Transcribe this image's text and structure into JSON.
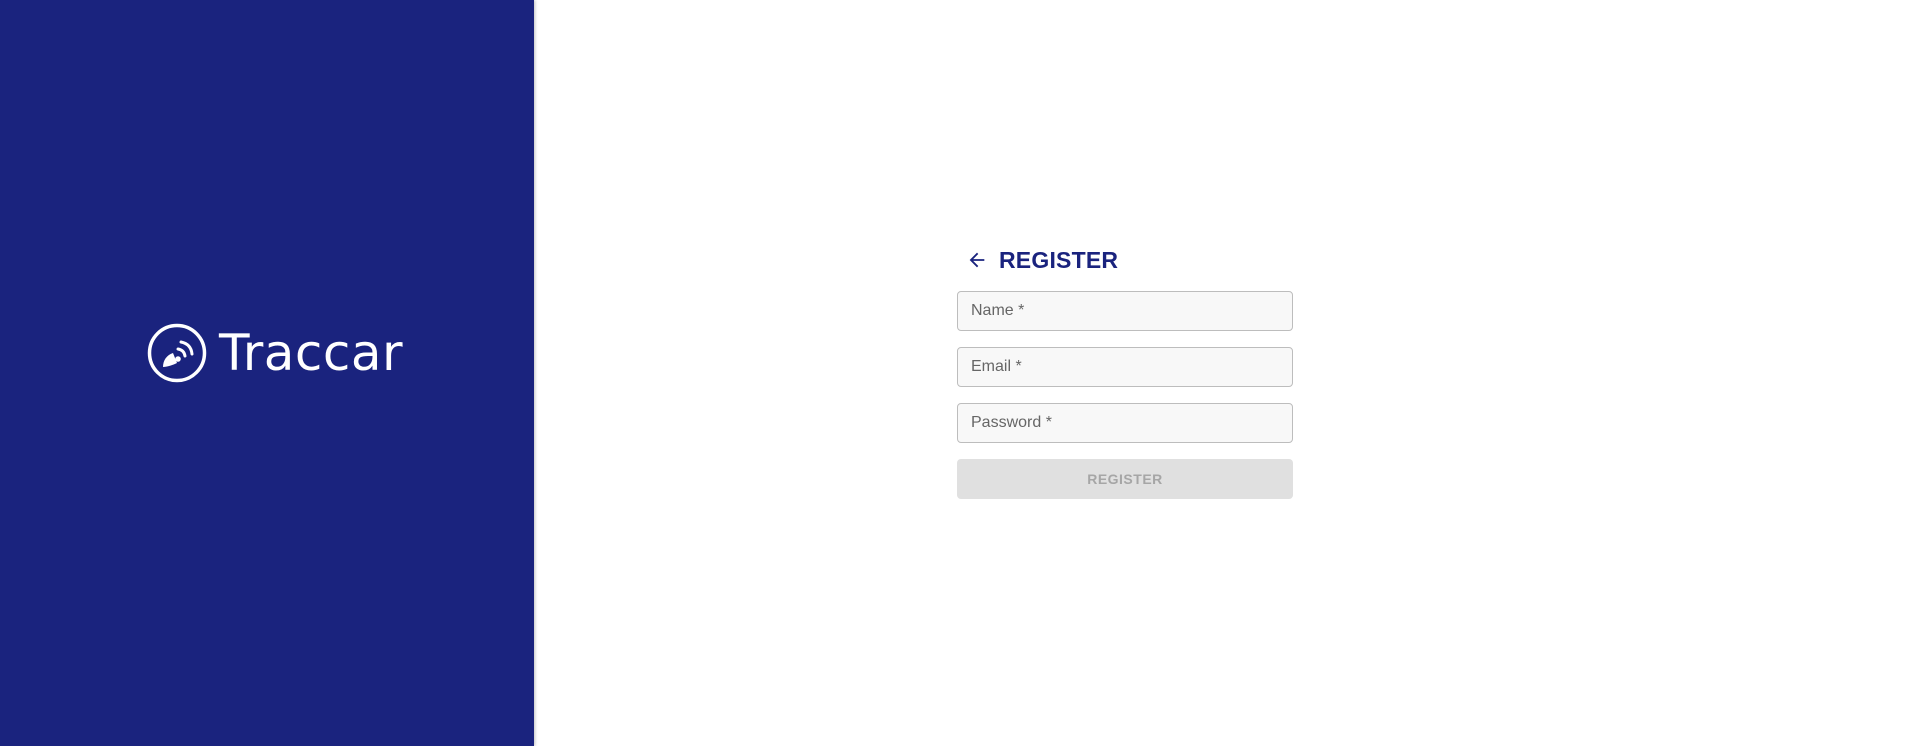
{
  "brand": {
    "name": "Traccar",
    "panel_color": "#1a237e",
    "logo_icon": "satellite-dish-icon"
  },
  "form": {
    "back_icon": "arrow-left-icon",
    "title": "REGISTER",
    "title_color": "#1a237e",
    "fields": {
      "name_placeholder": "Name *",
      "email_placeholder": "Email *",
      "password_placeholder": "Password *"
    },
    "submit_label": "REGISTER",
    "submit_disabled": true
  }
}
